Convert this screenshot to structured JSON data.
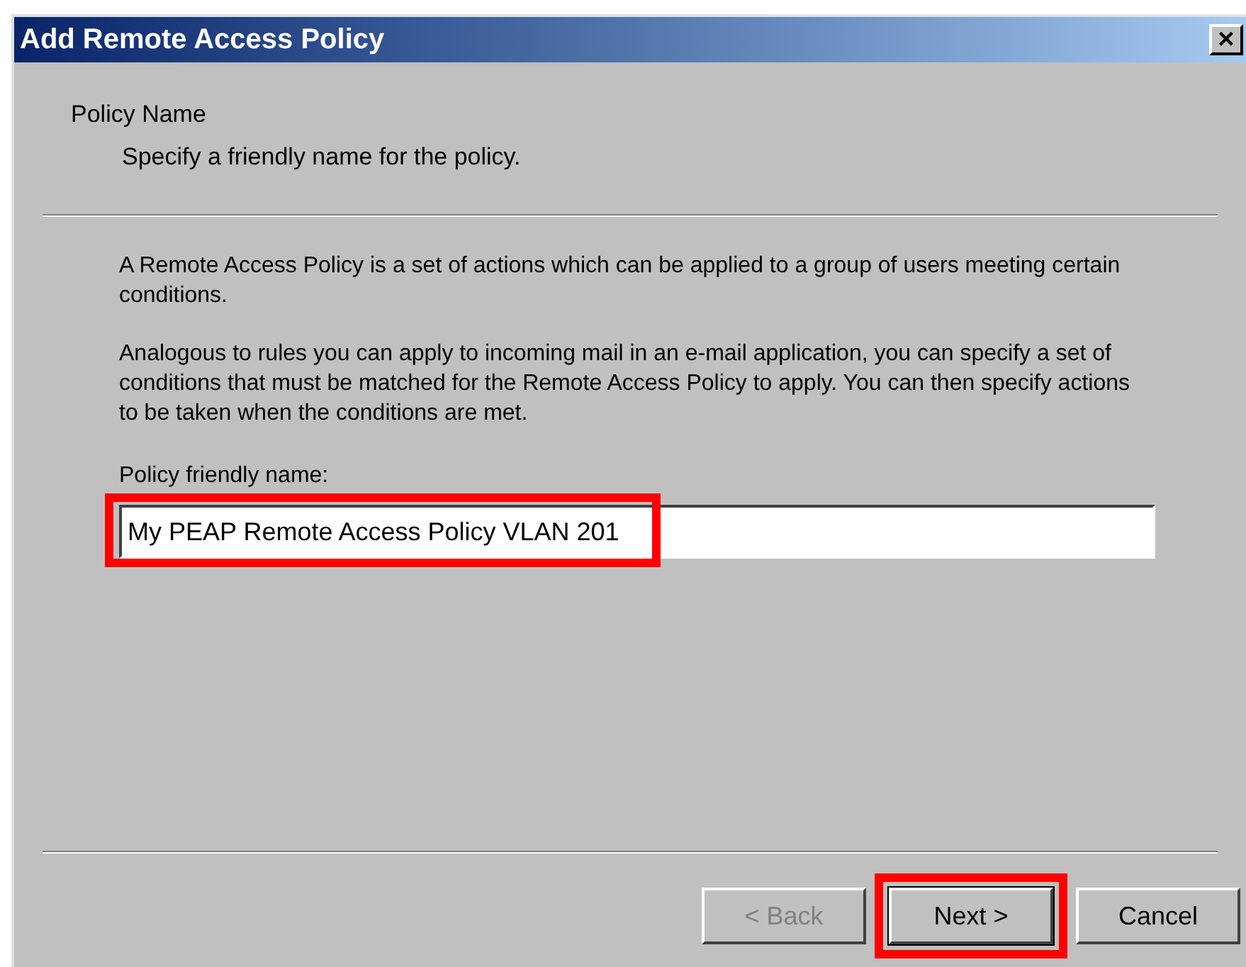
{
  "window": {
    "title": "Add Remote Access Policy",
    "close": "×"
  },
  "header": {
    "title": "Policy Name",
    "subtitle": "Specify a friendly name for the policy."
  },
  "paragraphs": [
    "A Remote Access Policy is a set of actions which can be applied to a group of users meeting certain conditions.",
    "Analogous to rules you can apply to incoming mail in an e-mail application, you can specify a set of conditions that must be matched for the Remote Access Policy to apply. You can then specify actions to be taken when the conditions are met."
  ],
  "field": {
    "label": "Policy friendly name:",
    "value": "My PEAP Remote Access Policy VLAN 201",
    "highlighted": true
  },
  "buttons": [
    {
      "label": "< Back",
      "disabled": true,
      "highlighted": false
    },
    {
      "label": "Next >",
      "disabled": false,
      "highlighted": true
    },
    {
      "label": "Cancel",
      "disabled": false,
      "highlighted": false
    }
  ]
}
